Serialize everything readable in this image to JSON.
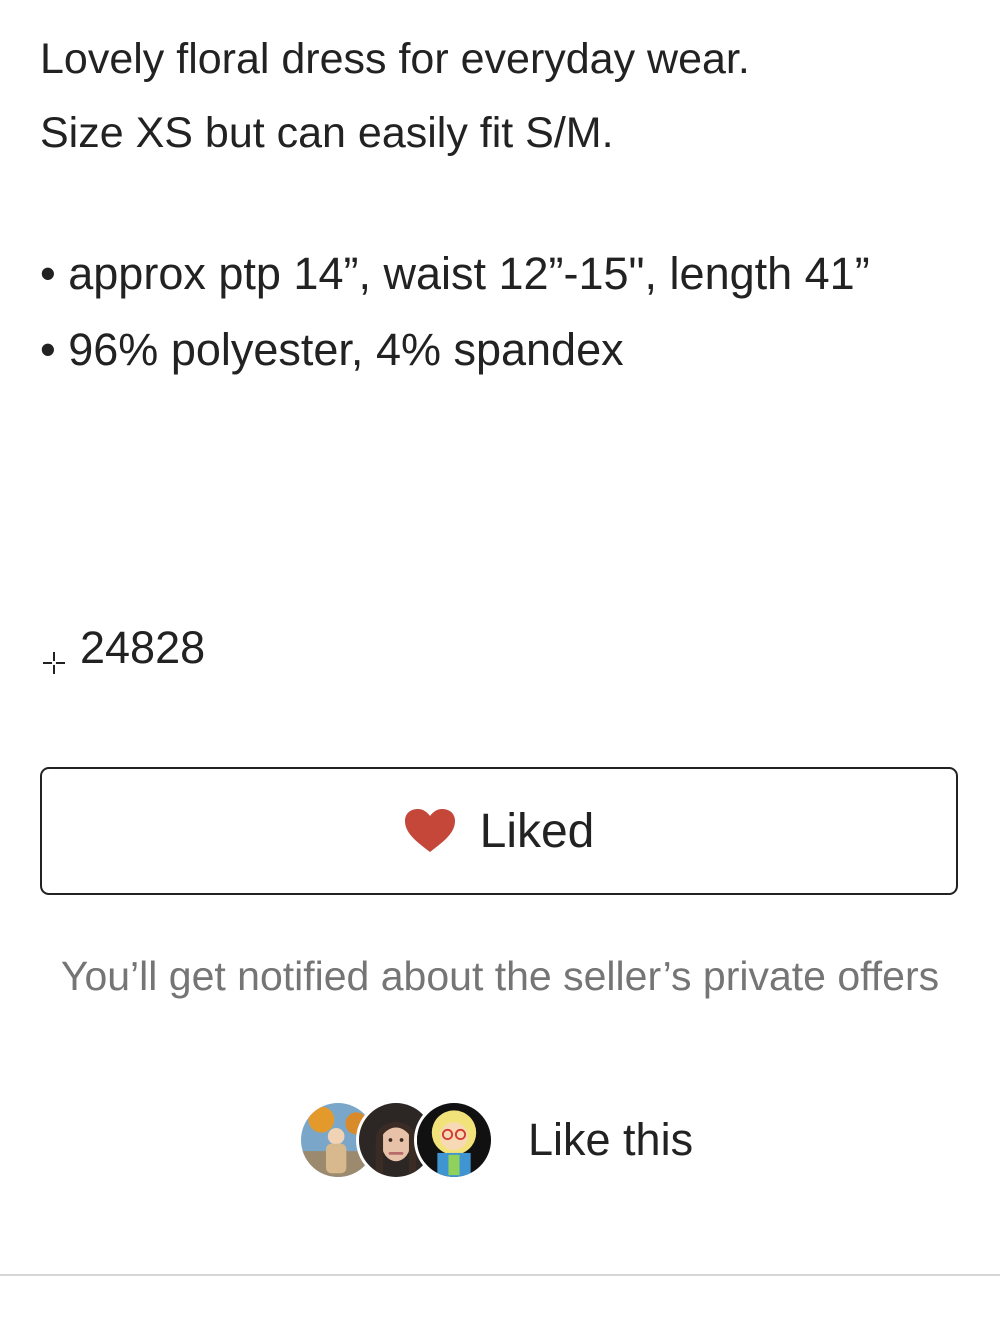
{
  "description": {
    "line1": "Lovely floral dress for everyday wear.",
    "line2": "Size XS but can easily fit S/M."
  },
  "bullets": [
    "• approx ptp 14”,  waist 12”-15\",  length 41”",
    "• 96% polyester,  4% spandex"
  ],
  "tag": {
    "icon": "sparkle-icon",
    "text": "24828"
  },
  "like_button": {
    "label": "Liked",
    "icon": "heart-icon",
    "heart_color": "#c4473a"
  },
  "notify_text": "You’ll get notified about the seller’s private offers",
  "likers": {
    "label": "Like this",
    "avatars": [
      "avatar-user-1",
      "avatar-user-2",
      "avatar-user-3"
    ]
  }
}
